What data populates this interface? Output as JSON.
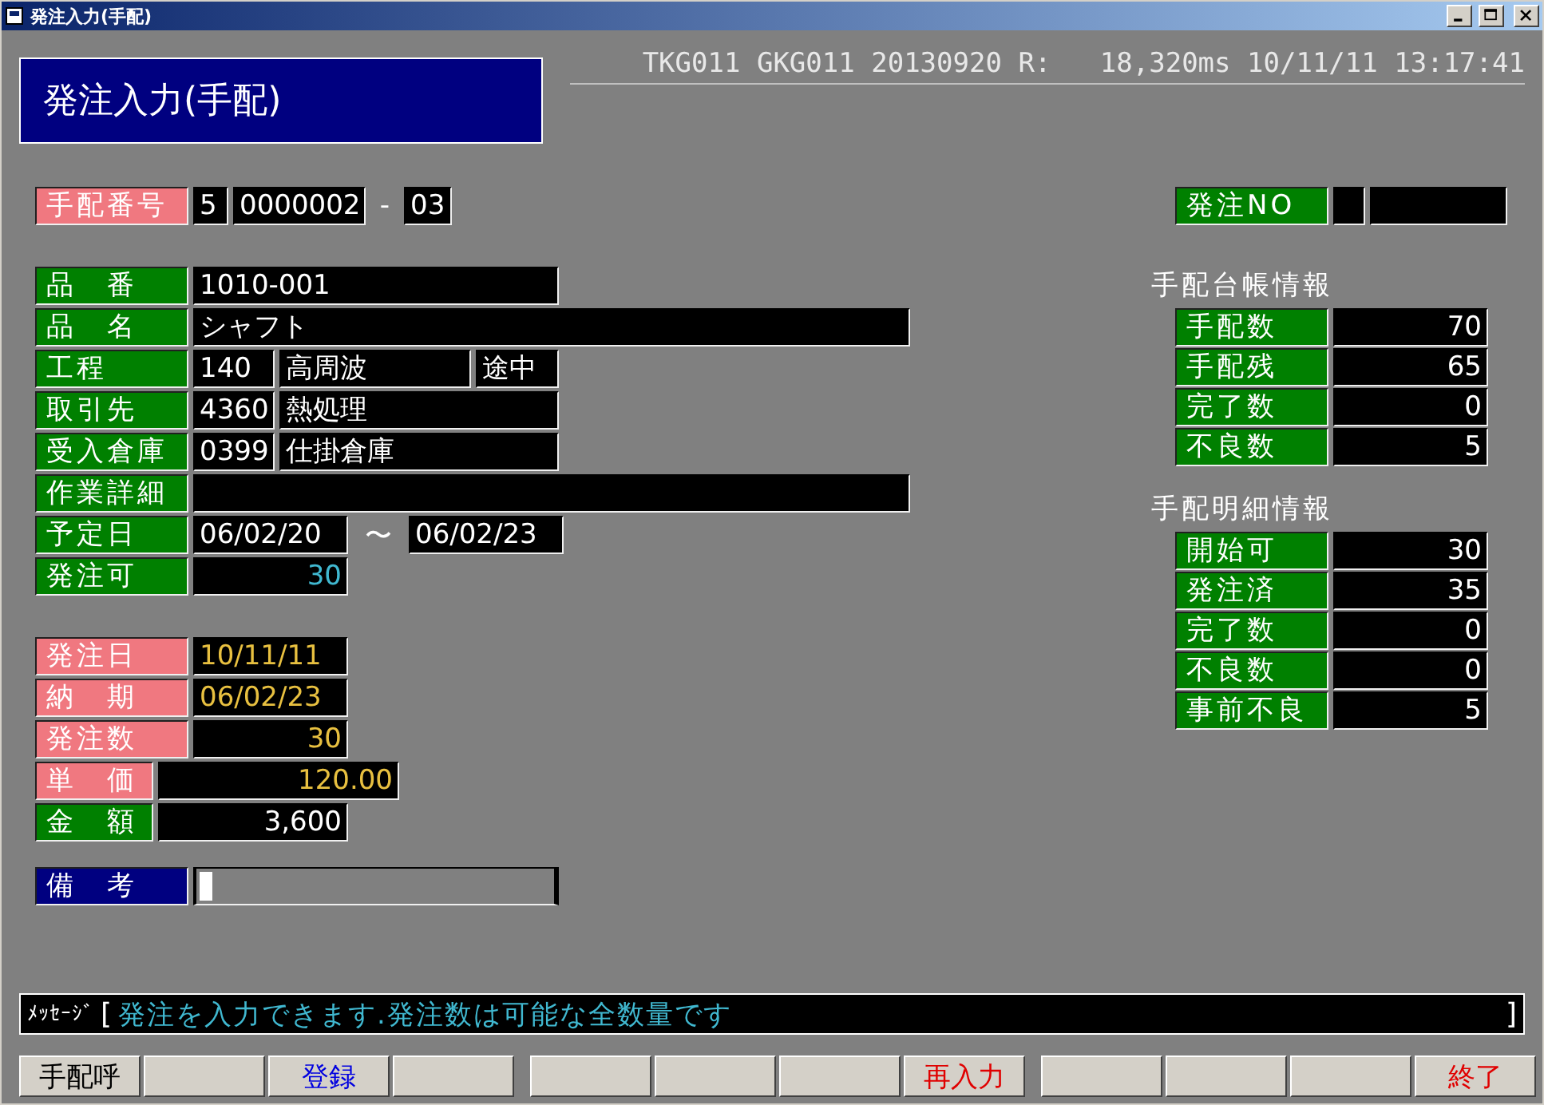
{
  "window": {
    "title": "発注入力(手配)"
  },
  "screen_title": "発注入力(手配)",
  "status_line": "TKG011 GKG011 20130920 R:   18,320ms 10/11/11 13:17:41",
  "order_number": {
    "label": "手配番号",
    "color": "#f07880",
    "values": [
      {
        "kind": "digit",
        "text": "5"
      },
      {
        "kind": "number",
        "text": "0000002"
      },
      {
        "kind": "separator",
        "text": "-"
      },
      {
        "kind": "suffix",
        "text": "03"
      }
    ]
  },
  "item_rows": [
    {
      "label": "品　番",
      "color": "#008000",
      "values": [
        {
          "kind": "medium",
          "text": "1010-001"
        }
      ]
    },
    {
      "label": "品　名",
      "color": "#008000",
      "values": [
        {
          "kind": "wide",
          "text": "シャフト"
        }
      ]
    },
    {
      "label": "工程",
      "color": "#008000",
      "values": [
        {
          "kind": "code",
          "text": "140"
        },
        {
          "kind": "desc",
          "text": "高周波"
        },
        {
          "kind": "flag",
          "text": "途中"
        }
      ]
    },
    {
      "label": "取引先",
      "color": "#008000",
      "values": [
        {
          "kind": "code",
          "text": "4360"
        },
        {
          "kind": "name",
          "text": "熱処理"
        }
      ]
    },
    {
      "label": "受入倉庫",
      "color": "#008000",
      "values": [
        {
          "kind": "code",
          "text": "0399"
        },
        {
          "kind": "name",
          "text": "仕掛倉庫"
        }
      ]
    },
    {
      "label": "作業詳細",
      "color": "#008000",
      "values": [
        {
          "kind": "wide"
        }
      ]
    },
    {
      "label": "予定日",
      "color": "#008000",
      "values": [
        {
          "kind": "date",
          "text": "06/02/20"
        },
        {
          "kind": "tilde",
          "text": "〜"
        },
        {
          "kind": "date",
          "text": "06/02/23"
        }
      ]
    },
    {
      "label": "発注可",
      "color": "#008000",
      "values": [
        {
          "kind": "qty",
          "text": "30",
          "color": "#40b8d0"
        }
      ]
    }
  ],
  "order_rows": [
    {
      "label": "発注日",
      "color": "#f07880",
      "kind": "normal",
      "values": [
        {
          "kind": "date",
          "text": "10/11/11",
          "color": "#e8c040"
        }
      ]
    },
    {
      "label": "納　期",
      "color": "#f07880",
      "kind": "normal",
      "values": [
        {
          "kind": "date",
          "text": "06/02/23",
          "color": "#e8c040"
        }
      ]
    },
    {
      "label": "発注数",
      "color": "#f07880",
      "kind": "normal",
      "values": [
        {
          "kind": "qty",
          "text": "30",
          "color": "#e8c040"
        }
      ]
    },
    {
      "label": "単　価",
      "color": "#f07880",
      "kind": "narrow",
      "values": [
        {
          "kind": "price",
          "text": "120.00",
          "color": "#e8c040"
        }
      ]
    },
    {
      "label": "金　額",
      "color": "#008000",
      "kind": "narrow",
      "values": [
        {
          "kind": "amount",
          "text": "3,600",
          "color": "#ffffff"
        }
      ]
    }
  ],
  "remarks": {
    "label": "備　考",
    "color": "#000080",
    "values": [
      {
        "kind": "memo"
      }
    ]
  },
  "order_no_panel": {
    "label": "発注NO",
    "color": "#008000",
    "values": [
      {
        "kind": "digit"
      },
      {
        "kind": "box"
      }
    ]
  },
  "info_sections": [
    {
      "title": "手配台帳情報",
      "rows": [
        {
          "label": "手配数",
          "value": "70"
        },
        {
          "label": "手配残",
          "value": "65"
        },
        {
          "label": "完了数",
          "value": "0"
        },
        {
          "label": "不良数",
          "value": "5"
        }
      ]
    },
    {
      "title": "手配明細情報",
      "rows": [
        {
          "label": "開始可",
          "value": "30"
        },
        {
          "label": "発注済",
          "value": "35"
        },
        {
          "label": "完了数",
          "value": "0"
        },
        {
          "label": "不良数",
          "value": "0"
        },
        {
          "label": "事前不良",
          "value": "5"
        }
      ]
    }
  ],
  "message": {
    "label": "ﾒｯｾｰｼﾞ",
    "open": "[",
    "text": "発注を入力できます.発注数は可能な全数量です",
    "close": "]"
  },
  "function_keys": [
    {
      "kind": "key",
      "label": "手配呼",
      "color": "#000000"
    },
    {
      "kind": "blank"
    },
    {
      "kind": "key",
      "label": "登録",
      "color": "#0000e0"
    },
    {
      "kind": "blank"
    },
    {
      "kind": "blank"
    },
    {
      "kind": "blank"
    },
    {
      "kind": "blank"
    },
    {
      "kind": "key",
      "label": "再入力",
      "color": "#e00000"
    },
    {
      "kind": "blank"
    },
    {
      "kind": "blank"
    },
    {
      "kind": "blank"
    },
    {
      "kind": "key",
      "label": "終了",
      "color": "#e00000"
    }
  ]
}
